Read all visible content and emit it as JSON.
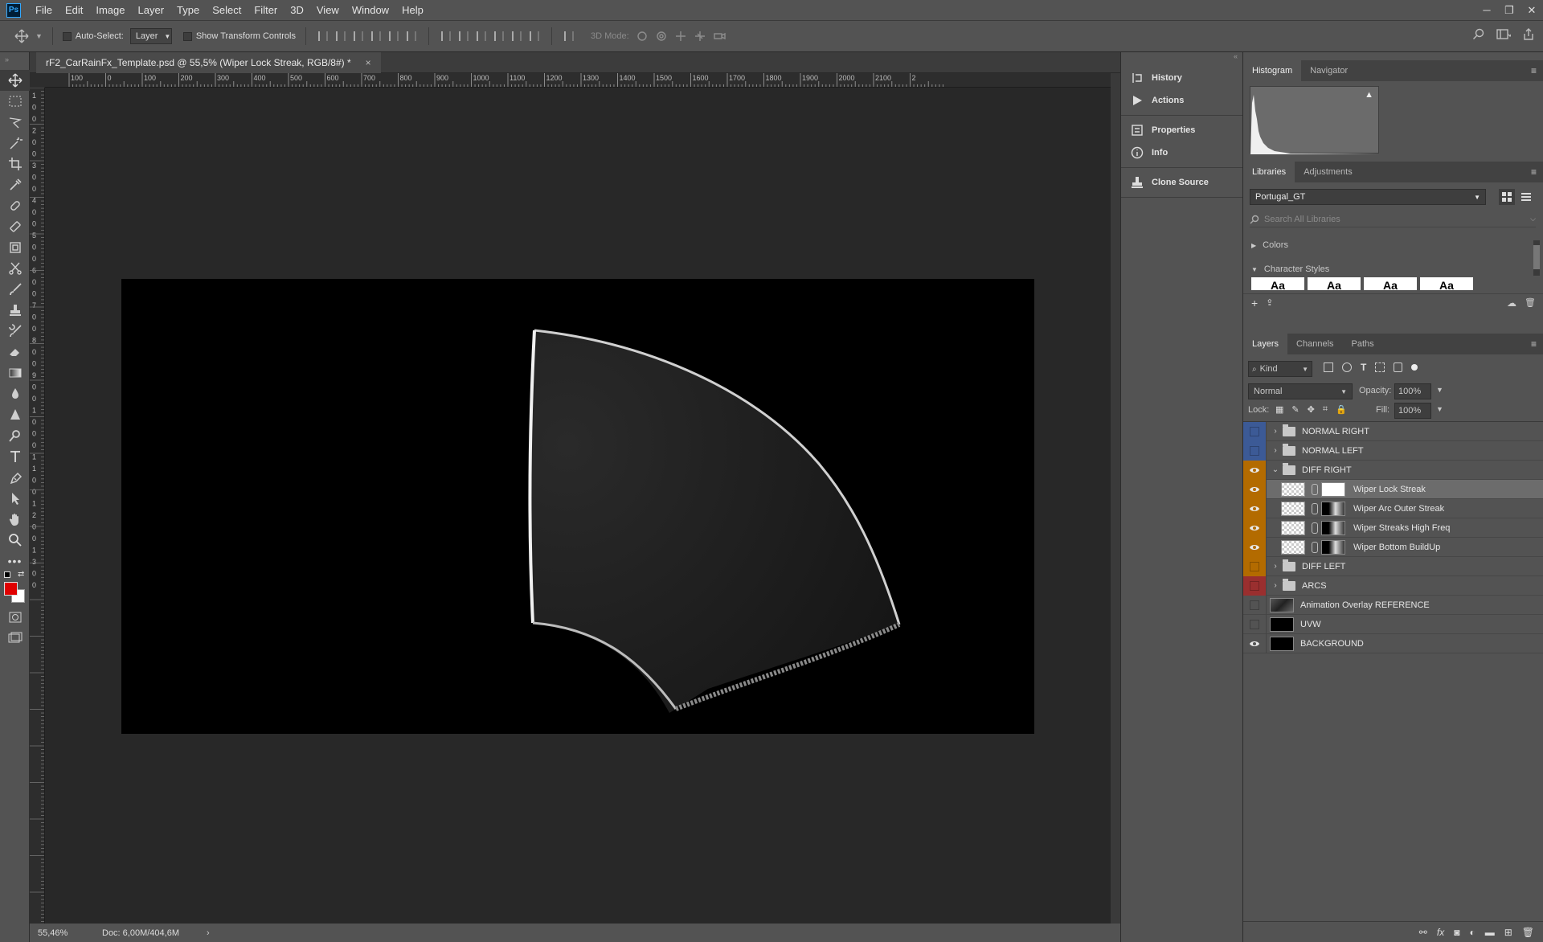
{
  "menu": [
    "File",
    "Edit",
    "Image",
    "Layer",
    "Type",
    "Select",
    "Filter",
    "3D",
    "View",
    "Window",
    "Help"
  ],
  "app_logo": "Ps",
  "options": {
    "auto_select_label": "Auto-Select:",
    "auto_select_value": "Layer",
    "transform_label": "Show Transform Controls",
    "mode_3d_label": "3D Mode:"
  },
  "document": {
    "tab_title": "rF2_CarRainFx_Template.psd @ 55,5% (Wiper Lock Streak, RGB/8#) *",
    "close_glyph": "×",
    "zoom": "55,46%",
    "doc_size": "Doc: 6,00M/404,6M",
    "ruler_top_labels": [
      "100",
      "0",
      "100",
      "200",
      "300",
      "400",
      "500",
      "600",
      "700",
      "800",
      "900",
      "1000",
      "1100",
      "1200",
      "1300",
      "1400",
      "1500",
      "1600",
      "1700",
      "1800",
      "1900",
      "2000",
      "2100",
      "2"
    ],
    "ruler_left_labels": [
      "1",
      "0",
      "0",
      "2",
      "0",
      "0",
      "3",
      "0",
      "0",
      "4",
      "0",
      "0",
      "5",
      "0",
      "0",
      "6",
      "0",
      "0",
      "7",
      "0",
      "0",
      "8",
      "0",
      "0",
      "9",
      "0",
      "0",
      "1",
      "0",
      "0",
      "0",
      "1",
      "1",
      "0",
      "0",
      "1",
      "2",
      "0",
      "0",
      "1",
      "3",
      "0",
      "0"
    ]
  },
  "collapsed_panels": {
    "history": "History",
    "actions": "Actions",
    "properties": "Properties",
    "info": "Info",
    "clone_source": "Clone Source"
  },
  "histogram_panel": {
    "tabs": [
      "Histogram",
      "Navigator"
    ],
    "warning_icon": "warning-icon"
  },
  "libraries_panel": {
    "tabs": [
      "Libraries",
      "Adjustments"
    ],
    "library_name": "Portugal_GT",
    "search_placeholder": "Search All Libraries",
    "section_colors": "Colors",
    "section_character_styles": "Character Styles",
    "style_glyph": "Aa"
  },
  "layers_panel": {
    "tabs": [
      "Layers",
      "Channels",
      "Paths"
    ],
    "kind_label": "Kind",
    "blend_mode": "Normal",
    "opacity_label": "Opacity:",
    "opacity_value": "100%",
    "lock_label": "Lock:",
    "fill_label": "Fill:",
    "fill_value": "100%",
    "layers": [
      {
        "name": "NORMAL RIGHT",
        "type": "group",
        "visible": false,
        "tag": "#3c5a96",
        "indent": 0,
        "expanded": false
      },
      {
        "name": "NORMAL LEFT",
        "type": "group",
        "visible": false,
        "tag": "#3c5a96",
        "indent": 0,
        "expanded": false
      },
      {
        "name": "DIFF RIGHT",
        "type": "group",
        "visible": true,
        "tag": "#b36b00",
        "indent": 0,
        "expanded": true
      },
      {
        "name": "Wiper Lock Streak",
        "type": "masked",
        "visible": true,
        "tag": "#b36b00",
        "indent": 1,
        "selected": true
      },
      {
        "name": "Wiper Arc Outer Streak",
        "type": "masked",
        "visible": true,
        "tag": "#b36b00",
        "indent": 1
      },
      {
        "name": "Wiper Streaks High Freq",
        "type": "masked",
        "visible": true,
        "tag": "#b36b00",
        "indent": 1
      },
      {
        "name": "Wiper Bottom BuildUp",
        "type": "masked",
        "visible": true,
        "tag": "#b36b00",
        "indent": 1
      },
      {
        "name": "DIFF LEFT",
        "type": "group",
        "visible": false,
        "tag": "#b36b00",
        "indent": 0,
        "expanded": false
      },
      {
        "name": "ARCS",
        "type": "group",
        "visible": false,
        "tag": "#9a2f2f",
        "indent": 0,
        "expanded": false
      },
      {
        "name": "Animation Overlay REFERENCE",
        "type": "layer",
        "visible": false,
        "tag": "",
        "indent": 0
      },
      {
        "name": "UVW",
        "type": "layer",
        "visible": false,
        "tag": "",
        "indent": 0
      },
      {
        "name": "BACKGROUND",
        "type": "layer",
        "visible": true,
        "tag": "",
        "indent": 0
      }
    ]
  },
  "colors": {
    "foreground": "#e00000",
    "background": "#ffffff",
    "accent": "#31a8ff"
  }
}
